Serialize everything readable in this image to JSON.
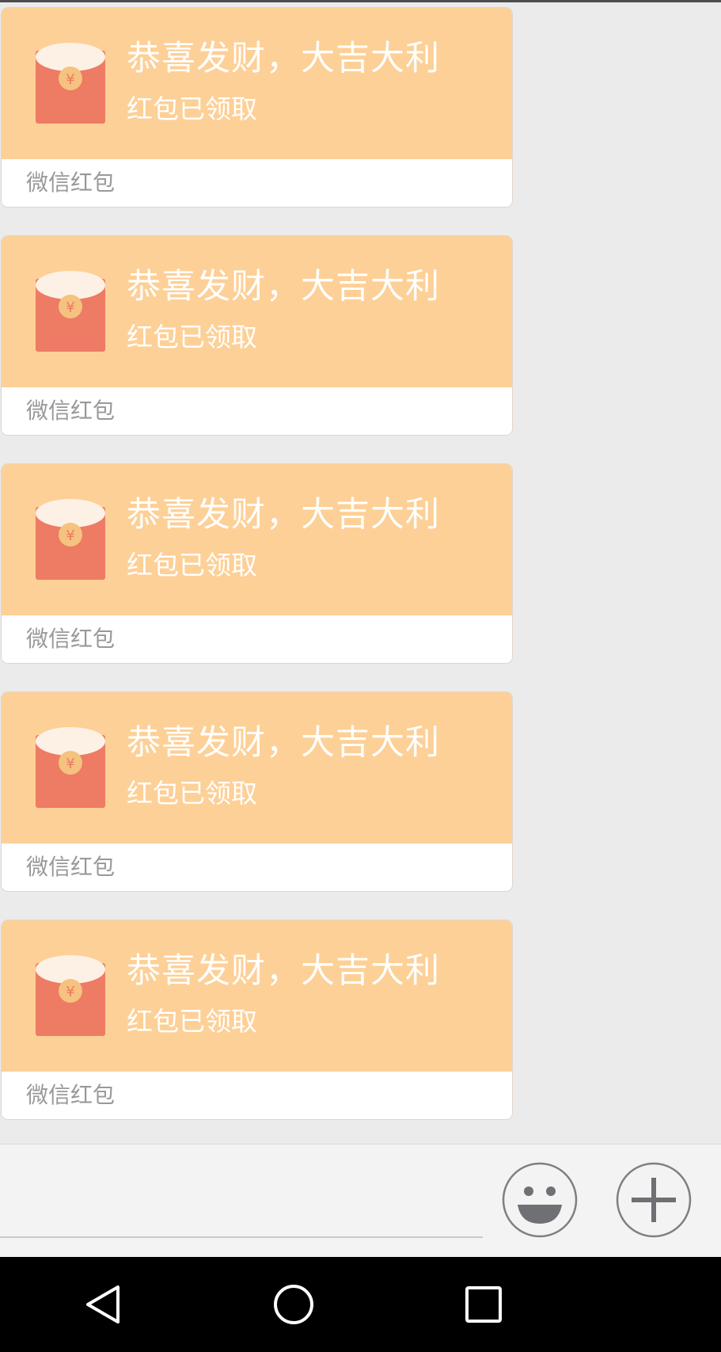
{
  "colors": {
    "chat_background": "#ebebeb",
    "red_packet_top": "#fdd097",
    "red_packet_footer": "#ffffff",
    "envelope_body": "#ee7b64",
    "envelope_flap": "#fdf1e6",
    "coin": "#f5c27f",
    "input_bar": "#f3f3f3",
    "nav_bar": "#000000"
  },
  "messages": [
    {
      "type": "red-packet",
      "icon": "red-envelope-icon",
      "title": "恭喜发财，大吉大利",
      "status": "红包已领取",
      "source": "微信红包"
    },
    {
      "type": "red-packet",
      "icon": "red-envelope-icon",
      "title": "恭喜发财，大吉大利",
      "status": "红包已领取",
      "source": "微信红包"
    },
    {
      "type": "red-packet",
      "icon": "red-envelope-icon",
      "title": "恭喜发财，大吉大利",
      "status": "红包已领取",
      "source": "微信红包"
    },
    {
      "type": "red-packet",
      "icon": "red-envelope-icon",
      "title": "恭喜发财，大吉大利",
      "status": "红包已领取",
      "source": "微信红包"
    },
    {
      "type": "red-packet",
      "icon": "red-envelope-icon",
      "title": "恭喜发财，大吉大利",
      "status": "红包已领取",
      "source": "微信红包"
    }
  ],
  "input_bar": {
    "text_value": "",
    "emoji_button_icon": "smiley-face-icon",
    "more_button_icon": "plus-icon"
  },
  "nav_bar": {
    "back_icon": "triangle-back-icon",
    "home_icon": "circle-home-icon",
    "recent_icon": "square-recents-icon"
  }
}
